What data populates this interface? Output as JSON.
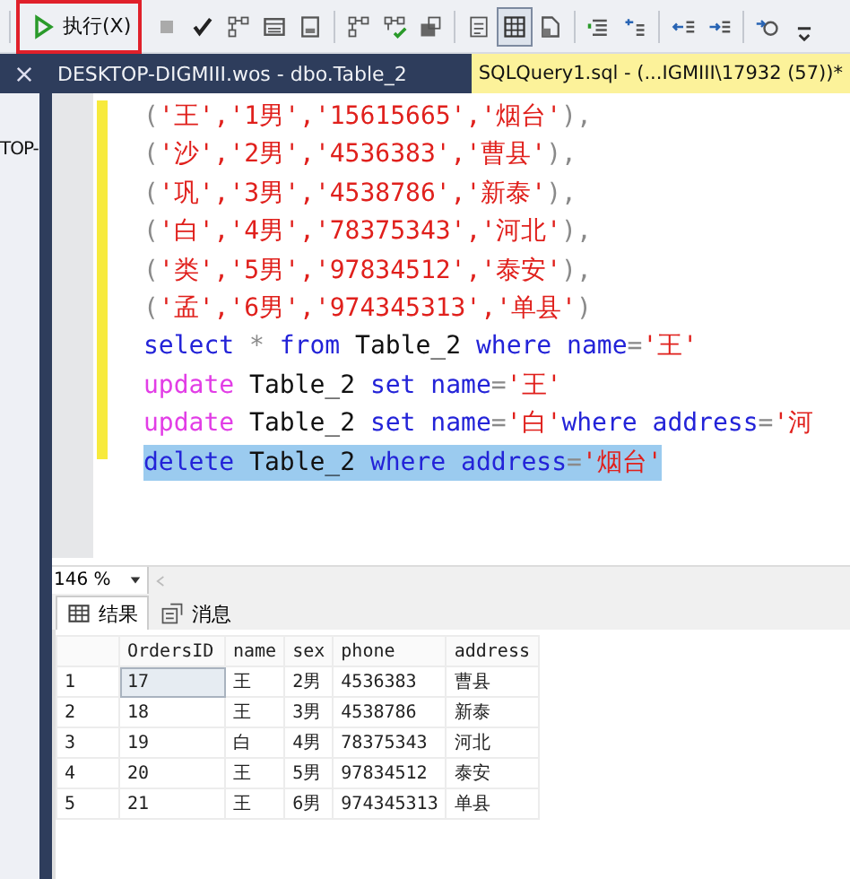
{
  "toolbar": {
    "execute_button": {
      "label": "执行(X)",
      "outlined": true
    },
    "buttons": [
      {
        "kind": "stop",
        "selected": false
      },
      {
        "kind": "check",
        "selected": false
      },
      {
        "kind": "tree",
        "selected": false
      },
      {
        "kind": "window",
        "selected": false
      },
      {
        "kind": "page",
        "selected": false
      },
      {
        "kind": "separator"
      },
      {
        "kind": "tree",
        "selected": false
      },
      {
        "kind": "tree-check",
        "selected": false
      },
      {
        "kind": "db",
        "selected": false
      },
      {
        "kind": "separator"
      },
      {
        "kind": "text",
        "selected": false
      },
      {
        "kind": "grid",
        "selected": true
      },
      {
        "kind": "file",
        "selected": false
      },
      {
        "kind": "separator"
      },
      {
        "kind": "lines",
        "selected": false
      },
      {
        "kind": "comment",
        "selected": false
      },
      {
        "kind": "separator"
      },
      {
        "kind": "outdent",
        "selected": false
      },
      {
        "kind": "indent",
        "selected": false
      },
      {
        "kind": "separator"
      },
      {
        "kind": "at",
        "selected": false
      },
      {
        "kind": "more",
        "selected": false
      }
    ]
  },
  "tabs": [
    {
      "label": "DESKTOP-DIGMIII.wos - dbo.Table_2",
      "selected": false
    },
    {
      "label": "SQLQuery1.sql - (...IGMIII\\17932 (57))*",
      "selected": true
    }
  ],
  "side_panel": {
    "text": "TOP-"
  },
  "code_lines": [
    {
      "selected": false,
      "segments": [
        {
          "kind": "punct",
          "text": "("
        },
        {
          "kind": "string",
          "text": "'王','1男','15615665','烟台'"
        },
        {
          "kind": "punct",
          "text": "),"
        }
      ]
    },
    {
      "selected": false,
      "segments": [
        {
          "kind": "punct",
          "text": "("
        },
        {
          "kind": "string",
          "text": "'沙','2男','4536383','曹县'"
        },
        {
          "kind": "punct",
          "text": "),"
        }
      ]
    },
    {
      "selected": false,
      "segments": [
        {
          "kind": "punct",
          "text": "("
        },
        {
          "kind": "string",
          "text": "'巩','3男','4538786','新泰'"
        },
        {
          "kind": "punct",
          "text": "),"
        }
      ]
    },
    {
      "selected": false,
      "segments": [
        {
          "kind": "punct",
          "text": "("
        },
        {
          "kind": "string",
          "text": "'白','4男','78375343','河北'"
        },
        {
          "kind": "punct",
          "text": "),"
        }
      ]
    },
    {
      "selected": false,
      "segments": [
        {
          "kind": "punct",
          "text": "("
        },
        {
          "kind": "string",
          "text": "'类','5男','97834512','泰安'"
        },
        {
          "kind": "punct",
          "text": "),"
        }
      ]
    },
    {
      "selected": false,
      "segments": [
        {
          "kind": "punct",
          "text": "("
        },
        {
          "kind": "string",
          "text": "'孟','6男','974345313','单县'"
        },
        {
          "kind": "punct",
          "text": ")"
        }
      ]
    },
    {
      "selected": false,
      "segments": [
        {
          "kind": "keyword",
          "text": "select "
        },
        {
          "kind": "punct",
          "text": "* "
        },
        {
          "kind": "keyword",
          "text": "from "
        },
        {
          "kind": "plain",
          "text": "Table_2 "
        },
        {
          "kind": "keyword",
          "text": "where name"
        },
        {
          "kind": "punct",
          "text": "="
        },
        {
          "kind": "string",
          "text": "'王'"
        }
      ]
    },
    {
      "selected": false,
      "segments": [
        {
          "kind": "dml",
          "text": "update "
        },
        {
          "kind": "plain",
          "text": "Table_2 "
        },
        {
          "kind": "keyword",
          "text": "set name"
        },
        {
          "kind": "punct",
          "text": "="
        },
        {
          "kind": "string",
          "text": "'王'"
        }
      ]
    },
    {
      "selected": false,
      "segments": [
        {
          "kind": "dml",
          "text": "update "
        },
        {
          "kind": "plain",
          "text": "Table_2 "
        },
        {
          "kind": "keyword",
          "text": "set name"
        },
        {
          "kind": "punct",
          "text": "="
        },
        {
          "kind": "string",
          "text": "'白'"
        },
        {
          "kind": "keyword",
          "text": "where address"
        },
        {
          "kind": "punct",
          "text": "="
        },
        {
          "kind": "string",
          "text": "'河"
        }
      ]
    },
    {
      "selected": true,
      "segments": [
        {
          "kind": "keyword",
          "text": "delete "
        },
        {
          "kind": "plain",
          "text": "Table_2 "
        },
        {
          "kind": "keyword",
          "text": "where address"
        },
        {
          "kind": "punct",
          "text": "="
        },
        {
          "kind": "string",
          "text": "'烟台'"
        }
      ]
    }
  ],
  "zoom": {
    "value": "146 %"
  },
  "result_tabs": [
    {
      "label": "结果",
      "kind": "grid",
      "selected": true
    },
    {
      "label": "消息",
      "kind": "message",
      "selected": false
    }
  ],
  "results": {
    "columns": [
      "OrdersID",
      "name",
      "sex",
      "phone",
      "address"
    ],
    "rows": [
      {
        "number": "1",
        "cells": [
          {
            "text": "17",
            "selected": true
          },
          {
            "text": "王",
            "selected": false
          },
          {
            "text": "2男",
            "selected": false
          },
          {
            "text": "4536383",
            "selected": false
          },
          {
            "text": "曹县",
            "selected": false
          }
        ]
      },
      {
        "number": "2",
        "cells": [
          {
            "text": "18",
            "selected": false
          },
          {
            "text": "王",
            "selected": false
          },
          {
            "text": "3男",
            "selected": false
          },
          {
            "text": "4538786",
            "selected": false
          },
          {
            "text": "新泰",
            "selected": false
          }
        ]
      },
      {
        "number": "3",
        "cells": [
          {
            "text": "19",
            "selected": false
          },
          {
            "text": "白",
            "selected": false
          },
          {
            "text": "4男",
            "selected": false
          },
          {
            "text": "78375343",
            "selected": false
          },
          {
            "text": "河北",
            "selected": false
          }
        ]
      },
      {
        "number": "4",
        "cells": [
          {
            "text": "20",
            "selected": false
          },
          {
            "text": "王",
            "selected": false
          },
          {
            "text": "5男",
            "selected": false
          },
          {
            "text": "97834512",
            "selected": false
          },
          {
            "text": "泰安",
            "selected": false
          }
        ]
      },
      {
        "number": "5",
        "cells": [
          {
            "text": "21",
            "selected": false
          },
          {
            "text": "王",
            "selected": false
          },
          {
            "text": "6男",
            "selected": false
          },
          {
            "text": "974345313",
            "selected": false
          },
          {
            "text": "单县",
            "selected": false
          }
        ]
      }
    ]
  }
}
